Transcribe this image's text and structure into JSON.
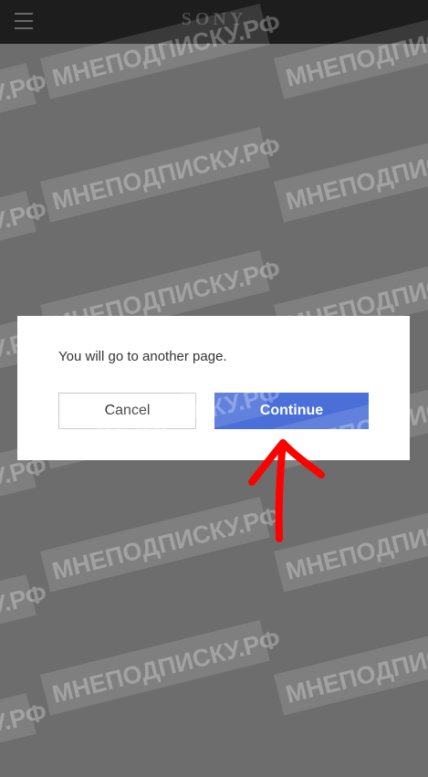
{
  "header": {
    "menu_icon": "hamburger-menu-icon",
    "brand": "SONY"
  },
  "dialog": {
    "message": "You will go to another page.",
    "cancel_label": "Cancel",
    "continue_label": "Continue"
  },
  "watermark": {
    "text": "МНЕПОДПИСКУ.РФ"
  },
  "colors": {
    "header_bg": "#1d1d1d",
    "overlay_bg": "#6d6d6d",
    "continue_button": "#4a6fd8",
    "annotation_arrow": "#ff0000"
  }
}
